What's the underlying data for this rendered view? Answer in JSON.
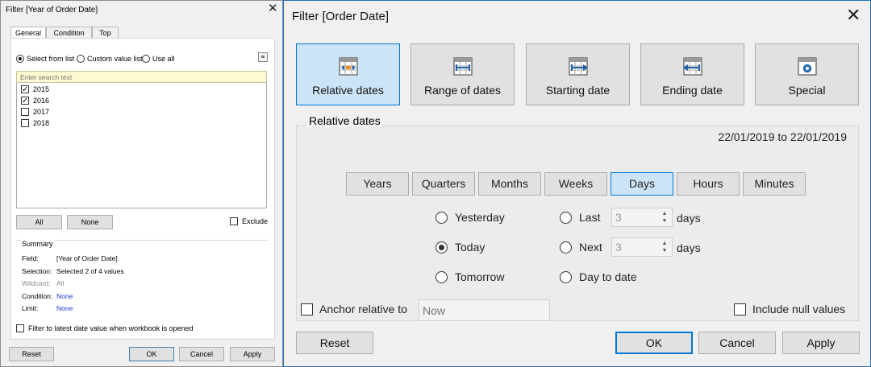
{
  "left_dialog": {
    "title": "Filter [Year of Order Date]",
    "tabs": [
      "General",
      "Condition",
      "Top"
    ],
    "radios": [
      "Select from list",
      "Custom value list",
      "Use all"
    ],
    "search_placeholder": "Enter search text",
    "items": [
      {
        "label": "2015",
        "checked": true
      },
      {
        "label": "2016",
        "checked": true
      },
      {
        "label": "2017",
        "checked": false
      },
      {
        "label": "2018",
        "checked": false
      }
    ],
    "all_label": "All",
    "none_label": "None",
    "exclude_label": "Exclude",
    "summary": {
      "header": "Summary",
      "field_key": "Field:",
      "field_val": "[Year of Order Date]",
      "selection_key": "Selection:",
      "selection_val": "Selected 2 of 4 values",
      "wildcard_key": "Wildcard:",
      "wildcard_val": "All",
      "condition_key": "Condition:",
      "condition_val": "None",
      "limit_key": "Limit:",
      "limit_val": "None"
    },
    "latest_label": "Filter to latest date value when workbook is opened",
    "buttons": {
      "reset": "Reset",
      "ok": "OK",
      "cancel": "Cancel",
      "apply": "Apply"
    }
  },
  "right_dialog": {
    "title": "Filter [Order Date]",
    "modes": [
      "Relative dates",
      "Range of dates",
      "Starting date",
      "Ending date",
      "Special"
    ],
    "panel_header": "Relative dates",
    "date_range": "22/01/2019 to 22/01/2019",
    "units": [
      "Years",
      "Quarters",
      "Months",
      "Weeks",
      "Days",
      "Hours",
      "Minutes"
    ],
    "selected_unit": "Days",
    "options_left": [
      "Yesterday",
      "Today",
      "Tomorrow"
    ],
    "options_right": [
      "Last",
      "Next",
      "Day to date"
    ],
    "last_value": "3",
    "next_value": "3",
    "days_label": "days",
    "anchor_label": "Anchor relative to",
    "anchor_placeholder": "Now",
    "null_label": "Include null values",
    "buttons": {
      "reset": "Reset",
      "ok": "OK",
      "cancel": "Cancel",
      "apply": "Apply"
    },
    "accent": "#0078d7"
  }
}
